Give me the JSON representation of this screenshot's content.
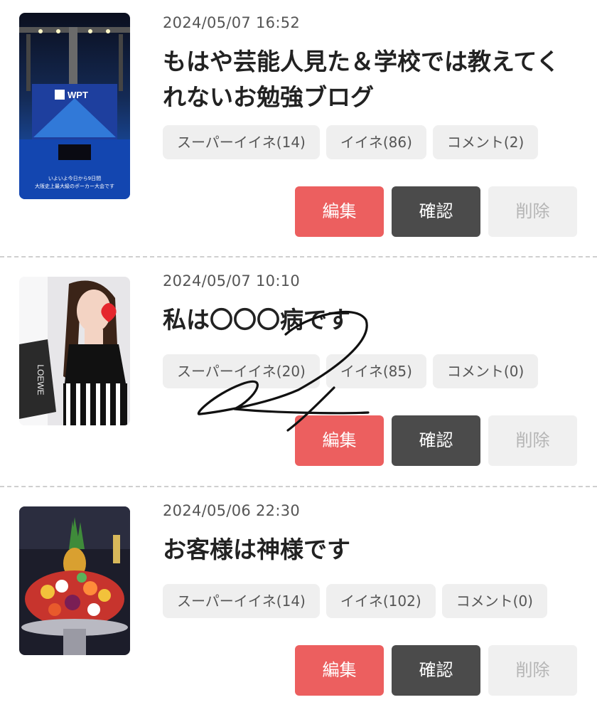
{
  "posts": [
    {
      "date": "2024/05/07 16:52",
      "title": "もはや芸能人見た＆学校では教えてくれないお勉強ブログ",
      "thumb_caption": "いよいよ今日から9日間\n大阪史上最大級のポーカー大会です🔥",
      "thumb_logo": "WPT",
      "stats": {
        "super_like": "スーパーイイネ(14)",
        "like": "イイネ(86)",
        "comment": "コメント(2)"
      },
      "actions": {
        "edit": "編集",
        "confirm": "確認",
        "delete": "削除"
      }
    },
    {
      "date": "2024/05/07 10:10",
      "title": "私は〇〇〇病です",
      "thumb_bag_text": "LOEWE",
      "stats": {
        "super_like": "スーパーイイネ(20)",
        "like": "イイネ(85)",
        "comment": "コメント(0)"
      },
      "actions": {
        "edit": "編集",
        "confirm": "確認",
        "delete": "削除"
      }
    },
    {
      "date": "2024/05/06 22:30",
      "title": "お客様は神様です",
      "stats": {
        "super_like": "スーパーイイネ(14)",
        "like": "イイネ(102)",
        "comment": "コメント(0)"
      },
      "actions": {
        "edit": "編集",
        "confirm": "確認",
        "delete": "削除"
      }
    }
  ],
  "colors": {
    "edit": "#ec5f5f",
    "confirm": "#4b4b4b",
    "delete": "#f0f0f0",
    "chip": "#efefef"
  }
}
